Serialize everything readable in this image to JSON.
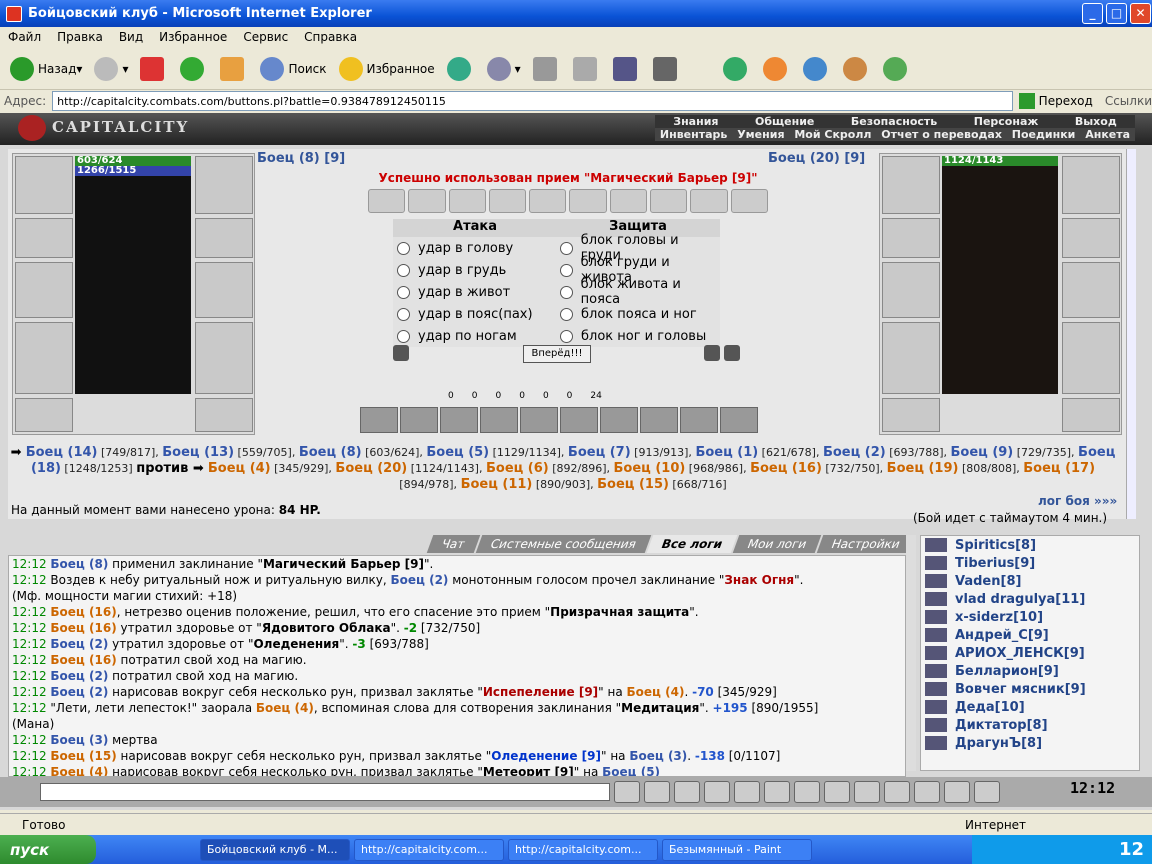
{
  "window": {
    "title": "Бойцовский клуб - Microsoft Internet Explorer"
  },
  "menu": [
    "Файл",
    "Правка",
    "Вид",
    "Избранное",
    "Сервис",
    "Справка"
  ],
  "toolbar": {
    "back": "Назад",
    "search": "Поиск",
    "favorites": "Избранное"
  },
  "address": {
    "label": "Адрес:",
    "url": "http://capitalcity.combats.com/buttons.pl?battle=0.938478912450115",
    "go": "Переход",
    "links": "Ссылки"
  },
  "game": {
    "logo": "CAPITALCITY",
    "menu_top": [
      "Знания",
      "Общение",
      "Безопасность",
      "Персонаж",
      "Выход"
    ],
    "menu_bottom": [
      "Инвентарь",
      "Умения",
      "Мой Скролл",
      "Отчет о переводах",
      "Поединки",
      "Анкета"
    ],
    "left_fighter": {
      "name": "Боец (8) [9]",
      "hp": "603/624",
      "mana": "1266/1515"
    },
    "right_fighter": {
      "name": "Боец (20) [9]",
      "hp": "1124/1143"
    },
    "message": "Успешно использован прием \"Магический Барьер [9]\"",
    "attack_header": "Атака",
    "defense_header": "Защита",
    "attack_options": [
      "удар в голову",
      "удар в грудь",
      "удар в живот",
      "удар в пояс(пах)",
      "удар по ногам"
    ],
    "defense_options": [
      "блок головы и груди",
      "блок груди и живота",
      "блок живота и пояса",
      "блок пояса и ног",
      "блок ног и головы"
    ],
    "go_button": "Вперёд!!!",
    "stats": [
      "0",
      "0",
      "0",
      "0",
      "0",
      "0",
      "24"
    ],
    "team1": [
      {
        "n": "Боец (14)",
        "h": "[749/817]"
      },
      {
        "n": "Боец (13)",
        "h": "[559/705]"
      },
      {
        "n": "Боец (8)",
        "h": "[603/624]"
      },
      {
        "n": "Боец (5)",
        "h": "[1129/1134]"
      },
      {
        "n": "Боец (7)",
        "h": "[913/913]"
      },
      {
        "n": "Боец (1)",
        "h": "[621/678]"
      },
      {
        "n": "Боец (2)",
        "h": "[693/788]"
      },
      {
        "n": "Боец (9)",
        "h": "[729/735]"
      },
      {
        "n": "Боец (18)",
        "h": "[1248/1253]"
      }
    ],
    "versus": "против",
    "team2": [
      {
        "n": "Боец (4)",
        "h": "[345/929]"
      },
      {
        "n": "Боец (20)",
        "h": "[1124/1143]"
      },
      {
        "n": "Боец (6)",
        "h": "[892/896]"
      },
      {
        "n": "Боец (10)",
        "h": "[968/986]"
      },
      {
        "n": "Боец (16)",
        "h": "[732/750]"
      },
      {
        "n": "Боец (19)",
        "h": "[808/808]"
      },
      {
        "n": "Боец (17)",
        "h": "[894/978]"
      },
      {
        "n": "Боец (11)",
        "h": "[890/903]"
      },
      {
        "n": "Боец (15)",
        "h": "[668/716]"
      }
    ],
    "damage_label": "На данный момент вами нанесено урона:",
    "damage_value": "84 HP.",
    "battle_log_link": "лог боя »»»",
    "timeout": "(Бой идет с таймаутом 4 мин.)",
    "tabs": [
      "Чат",
      "Системные сообщения",
      "Все логи",
      "Мои логи",
      "Настройки"
    ],
    "log": [
      {
        "t": "12:12",
        "html": "<span class='b'>Боец (8)</span> применил заклинание \"<span class='q'>Магический Барьер [9]</span>\"."
      },
      {
        "t": "12:12",
        "html": "Воздев к небу ритуальный нож и ритуальную вилку, <span class='b'>Боец (2)</span> монотонным голосом прочел заклинание \"<span class='red'>Знак Огня</span>\"."
      },
      {
        "t": "",
        "html": "(Мф. мощности магии стихий: +18)"
      },
      {
        "t": "12:12",
        "html": "<span class='o'>Боец (16)</span>, нетрезво оценив положение, решил, что его спасение это прием \"<span class='q'>Призрачная защита</span>\"."
      },
      {
        "t": "12:12",
        "html": "<span class='o'>Боец (16)</span> утратил здоровье от \"<span class='q'>Ядовитого Облака</span>\". <span class='minus'>-2</span> [732/750]"
      },
      {
        "t": "12:12",
        "html": "<span class='b'>Боец (2)</span> утратил здоровье от \"<span class='q'>Оледенения</span>\". <span class='minus'>-3</span> [693/788]"
      },
      {
        "t": "12:12",
        "html": "<span class='o'>Боец (16)</span> потратил свой ход на магию."
      },
      {
        "t": "12:12",
        "html": "<span class='b'>Боец (2)</span> потратил свой ход на магию."
      },
      {
        "t": "12:12",
        "html": "<span class='b'>Боец (2)</span> нарисовав вокруг себя несколько рун, призвал заклятье \"<span class='red'>Испепеление [9]</span>\" на <span class='o'>Боец (4)</span>. <span class='plus'>-70</span> [345/929]"
      },
      {
        "t": "12:12",
        "html": "\"Лети, лети лепесток!\" заорала <span class='o'>Боец (4)</span>, вспоминая слова для сотворения заклинания \"<span class='q'>Медитация</span>\". <span class='plus'>+195</span> [890/1955]"
      },
      {
        "t": "",
        "html": "(Мана)"
      },
      {
        "t": "12:12",
        "html": "<span class='b'>Боец (3)</span> мертва"
      },
      {
        "t": "12:12",
        "html": "<span class='o'>Боец (15)</span> нарисовав вокруг себя несколько рун, призвал заклятье \"<span class='blu'>Оледенение [9]</span>\" на <span class='b'>Боец (3)</span>. <span class='plus'>-138</span> [0/1107]"
      },
      {
        "t": "12:12",
        "html": "<span class='o'>Боец (4)</span> нарисовав вокруг себя несколько рун, призвал заклятье \"<span class='q'>Метеорит [9]</span>\" на <span class='b'>Боец (5)</span>"
      }
    ],
    "users": [
      "Spiritics[8]",
      "Tiberius[9]",
      "Vaden[8]",
      "vlad dragulya[11]",
      "x-siderz[10]",
      "Андрей_С[9]",
      "АРИОХ_ЛЕНСК[9]",
      "Белларион[9]",
      "Вовчег мясник[9]",
      "Деда[10]",
      "Диктатор[8]",
      "ДрагунЪ[8]"
    ],
    "clock": "12:12"
  },
  "status": {
    "left": "Готово",
    "right": "Интернет"
  },
  "taskbar": {
    "start": "пуск",
    "tasks": [
      "Бойцовский клуб - М...",
      "http://capitalcity.com...",
      "http://capitalcity.com...",
      "Безымянный - Paint"
    ],
    "time": "12"
  }
}
